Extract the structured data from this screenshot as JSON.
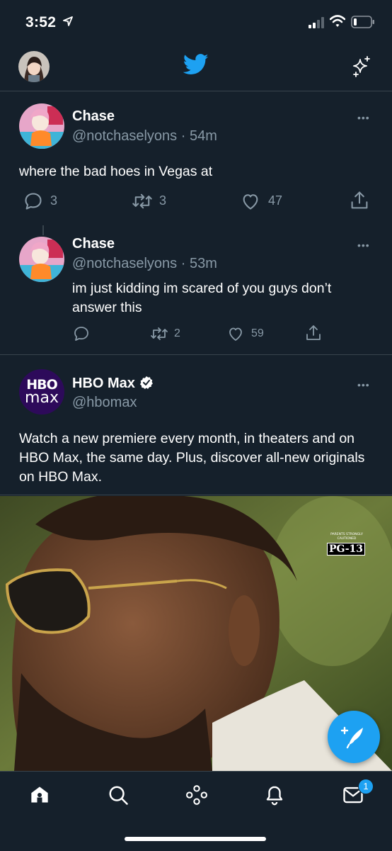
{
  "status_bar": {
    "time": "3:52"
  },
  "tweets": [
    {
      "name": "Chase",
      "handle": "@notchaselyons",
      "time": "· 54m",
      "text": "where the bad hoes in Vegas at",
      "replies": "3",
      "retweets": "3",
      "likes": "47"
    },
    {
      "name": "Chase",
      "handle": "@notchaselyons",
      "time": "· 53m",
      "text": "im just kidding im scared of you guys don’t answer this",
      "replies": "",
      "retweets": "2",
      "likes": "59"
    }
  ],
  "promoted": {
    "name": "HBO Max",
    "handle": "@hbomax",
    "logo_line1": "HBO",
    "logo_line2": "max",
    "text": "Watch a new premiere every month, in theaters and on HBO Max, the same day. Plus, discover all-new originals on HBO Max.",
    "rating_top": "PARENTS STRONGLY CAUTIONED",
    "rating": "PG-13"
  },
  "tab_bar": {
    "messages_badge": "1"
  },
  "colors": {
    "background": "#15202b",
    "accent": "#1da1f2",
    "secondary_text": "#8899a6",
    "divider": "#38444d"
  },
  "icons": [
    "location-arrow-icon",
    "signal-icon",
    "wifi-icon",
    "battery-icon",
    "twitter-bird-icon",
    "sparkle-icon",
    "more-icon",
    "reply-icon",
    "retweet-icon",
    "like-icon",
    "share-icon",
    "verified-icon",
    "compose-icon",
    "home-icon",
    "search-icon",
    "spaces-icon",
    "notifications-icon",
    "messages-icon"
  ]
}
